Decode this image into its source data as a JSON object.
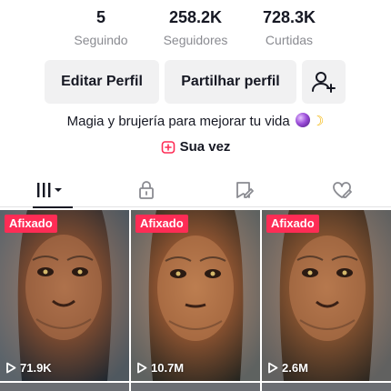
{
  "stats": [
    {
      "value": "5",
      "label": "Seguindo"
    },
    {
      "value": "258.2K",
      "label": "Seguidores"
    },
    {
      "value": "728.3K",
      "label": "Curtidas"
    }
  ],
  "buttons": {
    "edit_label": "Editar Perfil",
    "share_label": "Partilhar perfil",
    "add_friend_icon": "add-person-icon"
  },
  "bio": {
    "text": "Magia y brujería para mejorar tu vida",
    "emojis": [
      "crystal-ball",
      "crescent-moon"
    ]
  },
  "link": {
    "label": "Sua vez",
    "icon": "plus-square-icon"
  },
  "tabs": [
    {
      "icon": "grid-bars-icon",
      "active": true
    },
    {
      "icon": "lock-icon",
      "active": false
    },
    {
      "icon": "bookmark-icon",
      "active": false
    },
    {
      "icon": "liked-heart-icon",
      "active": false
    }
  ],
  "videos": [
    {
      "badge": "Afixado",
      "views": "71.9K"
    },
    {
      "badge": "Afixado",
      "views": "10.7M"
    },
    {
      "badge": "Afixado",
      "views": "2.6M"
    }
  ],
  "colors": {
    "accent": "#fe2c55",
    "text": "#161823",
    "muted": "#8a8b91",
    "button_bg": "#f1f1f2"
  }
}
